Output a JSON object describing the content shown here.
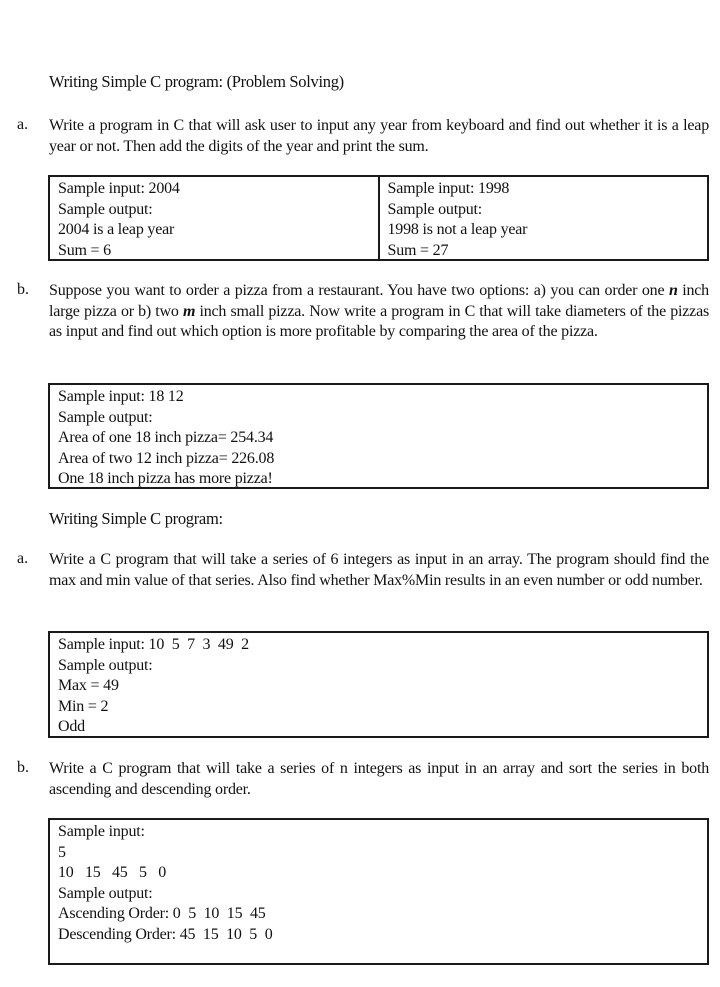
{
  "section1": {
    "heading": "Writing Simple C program: (Problem Solving)",
    "items": [
      {
        "label": "a.",
        "text": "Write a program in C that will ask user to input any year from keyboard and find out whether it is a leap year or not. Then add the digits of the year and print the sum.",
        "samples": [
          {
            "lines": [
              "Sample input: 2004",
              "Sample output:",
              "2004 is a leap year",
              "Sum = 6"
            ]
          },
          {
            "lines": [
              "Sample input: 1998",
              "Sample output:",
              "1998 is not a leap year",
              "Sum = 27"
            ]
          }
        ]
      },
      {
        "label": "b.",
        "text_parts": [
          "Suppose you want to order a pizza from a restaurant. You have two options: a) you can order one ",
          "n",
          " inch large pizza or b) two ",
          "m",
          " inch small pizza. Now write a program in C that will take diameters of the pizzas as input and find out which option is more profitable by comparing the area of the pizza."
        ],
        "sample": {
          "lines": [
            "Sample input: 18 12",
            "Sample output:",
            "Area of one 18 inch pizza= 254.34",
            "Area of two 12 inch pizza= 226.08",
            "One 18 inch pizza has more pizza!"
          ]
        }
      }
    ]
  },
  "section2": {
    "heading": "Writing Simple C program:",
    "items": [
      {
        "label": "a.",
        "text": "Write a C program that will take a series of 6 integers as input in an array. The program should find the max and min value of that series. Also find whether Max%Min results in an even number or odd number.",
        "sample": {
          "lines": [
            "Sample input: 10  5  7  3  49  2",
            "Sample output:",
            "Max = 49",
            "Min = 2",
            "Odd"
          ]
        }
      },
      {
        "label": "b.",
        "text": "Write a C program that will take a series of n integers as input in an array and sort the series in both ascending and descending order.",
        "sample": {
          "lines": [
            "Sample input:",
            "5",
            "10   15   45   5   0",
            "Sample output:",
            "Ascending Order: 0  5  10  15  45",
            "Descending Order: 45  15  10  5  0"
          ]
        }
      }
    ]
  }
}
